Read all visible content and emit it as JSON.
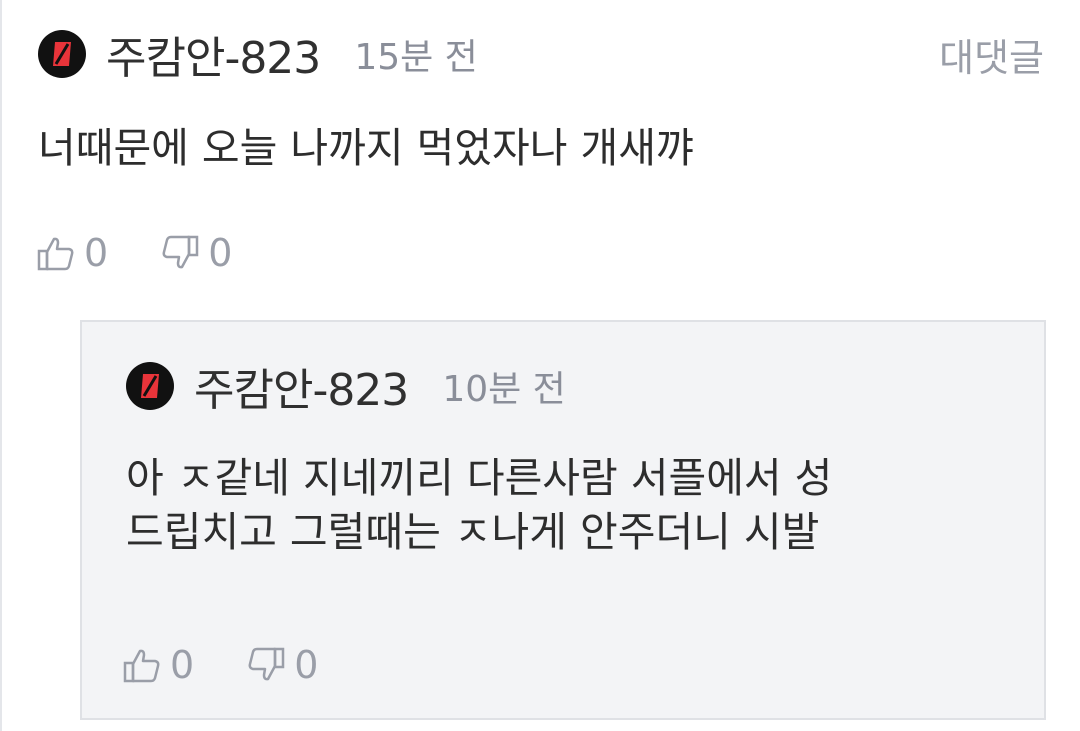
{
  "comment": {
    "username": "주캄안-823",
    "time": "15분 전",
    "reply_label": "대댓글",
    "text": "너때문에 오늘 나까지 먹었자나 개새꺄",
    "likes": "0",
    "dislikes": "0"
  },
  "reply": {
    "username": "주캄안-823",
    "time": "10분 전",
    "text_lines": [
      "아 ㅈ같네 지네끼리 다른사람 서플에서 성",
      "드립치고 그럴때는 ㅈ나게 안주더니 시발"
    ],
    "likes": "0",
    "dislikes": "0"
  },
  "colors": {
    "avatar_bg": "#111111",
    "avatar_accent": "#e8343a",
    "muted": "#9a9ea8",
    "text": "#2d2d2d",
    "reply_bg": "#f3f4f6"
  },
  "icons": {
    "avatar": "red-slash-logo",
    "like": "thumbs-up-icon",
    "dislike": "thumbs-down-icon"
  }
}
